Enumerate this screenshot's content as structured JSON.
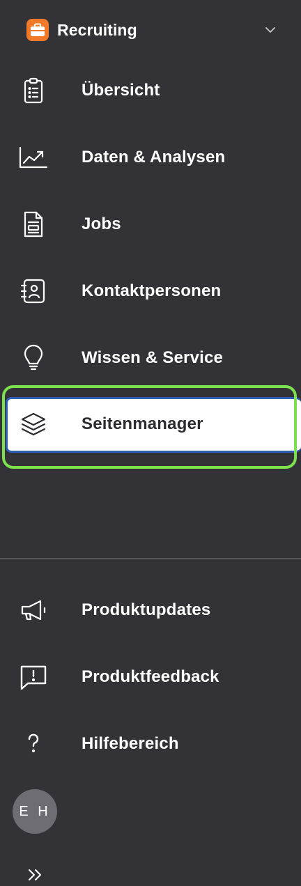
{
  "app_switcher": {
    "name": "Recruiting",
    "icon": "briefcase-icon"
  },
  "nav": [
    {
      "label": "Übersicht",
      "icon": "clipboard-list-icon",
      "active": false
    },
    {
      "label": "Daten & Analysen",
      "icon": "chart-trend-icon",
      "active": false
    },
    {
      "label": "Jobs",
      "icon": "document-icon",
      "active": false
    },
    {
      "label": "Kontaktpersonen",
      "icon": "contact-card-icon",
      "active": false
    },
    {
      "label": "Wissen & Service",
      "icon": "lightbulb-icon",
      "active": false
    },
    {
      "label": "Seitenmanager",
      "icon": "layers-icon",
      "active": true
    }
  ],
  "footer_nav": [
    {
      "label": "Produktupdates",
      "icon": "megaphone-icon"
    },
    {
      "label": "Produktfeedback",
      "icon": "feedback-icon"
    },
    {
      "label": "Hilfebereich",
      "icon": "question-icon"
    }
  ],
  "avatar": {
    "initials": "E H"
  },
  "colors": {
    "background": "#333236",
    "accent": "#f07a2a",
    "focus": "#7de04f",
    "active_border": "#2f5fb5"
  }
}
